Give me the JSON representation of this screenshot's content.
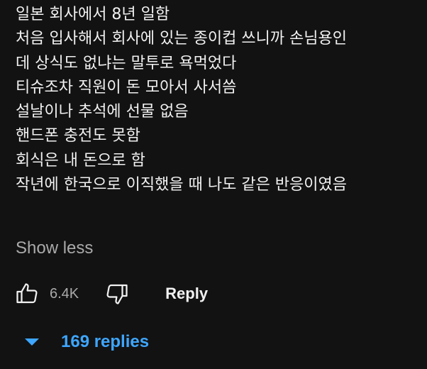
{
  "comment": {
    "lines": [
      "일본 회사에서 8년 일함",
      "처음 입사해서 회사에 있는 종이컵 쓰니까 손님용인",
      "데 상식도 없냐는 말투로 욕먹었다",
      "티슈조차 직원이 돈 모아서 사서씀",
      "설날이나 추석에 선물 없음",
      "핸드폰 충전도 못함",
      "회식은 내 돈으로 함",
      "작년에 한국으로 이직했을 때 나도 같은 반응이였음"
    ],
    "show_less_label": "Show less"
  },
  "actions": {
    "like_icon": "thumbs-up-icon",
    "like_count": "6.4K",
    "dislike_icon": "thumbs-down-icon",
    "reply_label": "Reply"
  },
  "replies": {
    "toggle_icon": "caret-down-icon",
    "label": "169 replies",
    "accent_color": "#3ea6ff"
  }
}
